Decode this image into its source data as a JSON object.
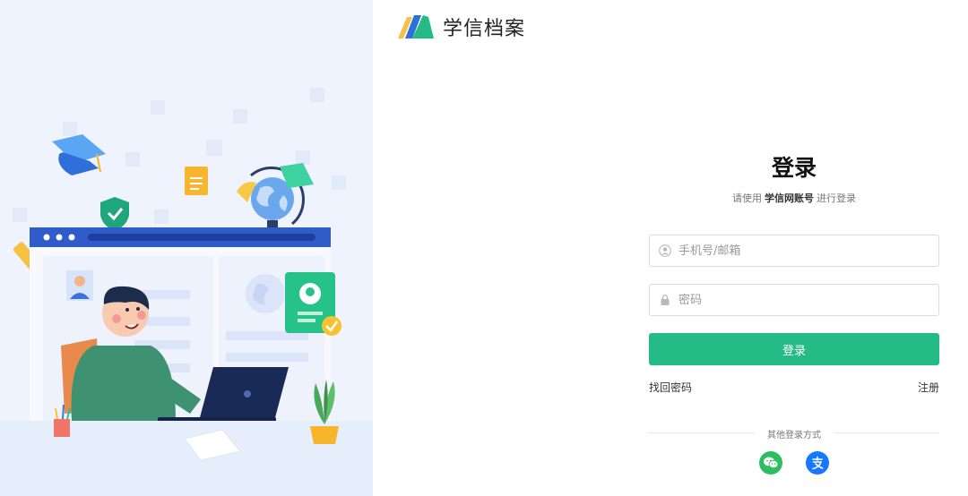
{
  "brand": {
    "name": "学信档案"
  },
  "login": {
    "title": "登录",
    "subtitle_pre": "请使用",
    "subtitle_account": "学信网账号",
    "subtitle_post": "进行登录",
    "username_placeholder": "手机号/邮箱",
    "password_placeholder": "密码",
    "submit_label": "登录",
    "forgot_label": "找回密码",
    "register_label": "注册",
    "other_methods_label": "其他登录方式"
  },
  "colors": {
    "primary": "#25bb86",
    "wechat": "#2dbe60",
    "alipay": "#1677ff"
  },
  "icons": {
    "wechat": "wechat-icon",
    "alipay": "alipay-icon",
    "user": "user-icon",
    "lock": "lock-icon"
  }
}
